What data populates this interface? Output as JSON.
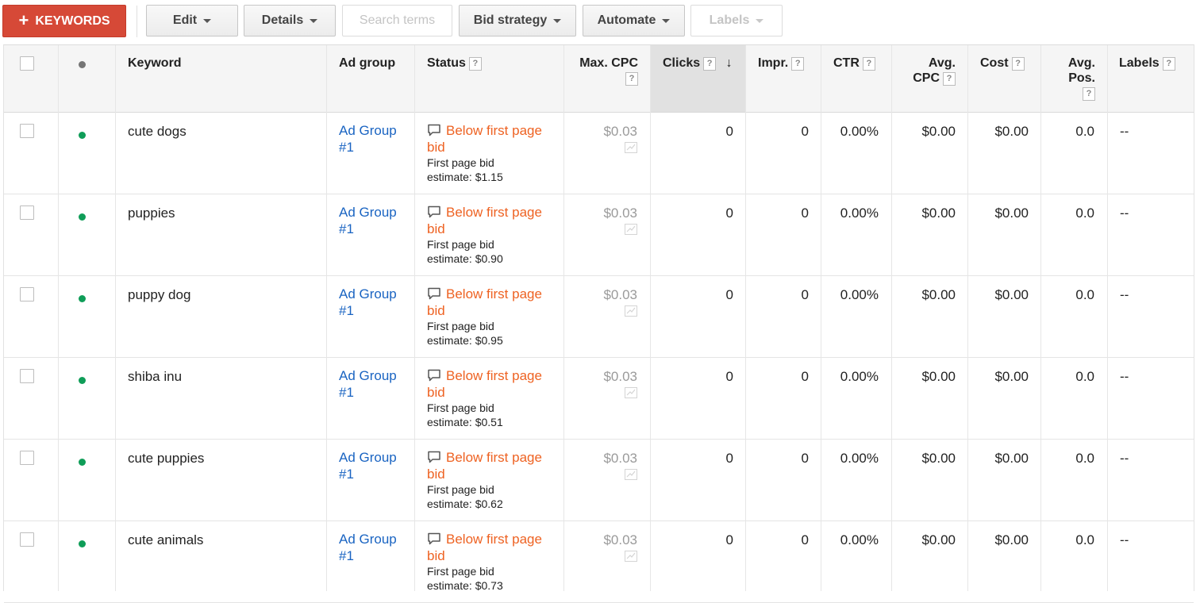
{
  "toolbar": {
    "add_keywords_label": "KEYWORDS",
    "edit_label": "Edit",
    "details_label": "Details",
    "search_terms_label": "Search terms",
    "bid_strategy_label": "Bid strategy",
    "automate_label": "Automate",
    "labels_label": "Labels"
  },
  "columns": {
    "keyword": "Keyword",
    "ad_group": "Ad group",
    "status": "Status",
    "max_cpc": "Max. CPC",
    "clicks": "Clicks",
    "impr": "Impr.",
    "ctr": "CTR",
    "avg_cpc_1": "Avg.",
    "avg_cpc_2": "CPC",
    "cost": "Cost",
    "avg_pos_1": "Avg.",
    "avg_pos_2": "Pos.",
    "labels": "Labels",
    "help_glyph": "?",
    "sort_arrow": "↓"
  },
  "colors": {
    "primary_red": "#d64937",
    "link_blue": "#1a64c2",
    "status_orange": "#ee6222",
    "enabled_green": "#0f9d58",
    "header_dot_gray": "#757575"
  },
  "rows": [
    {
      "keyword": "cute dogs",
      "ad_group_1": "Ad Group",
      "ad_group_2": "#1",
      "status_1": "Below first page",
      "status_2": "bid",
      "status_sub_1": "First page bid",
      "status_sub_2": "estimate: $1.15",
      "max_cpc": "$0.03",
      "clicks": "0",
      "impr": "0",
      "ctr": "0.00%",
      "avg_cpc": "$0.00",
      "cost": "$0.00",
      "avg_pos": "0.0",
      "labels": "--"
    },
    {
      "keyword": "puppies",
      "ad_group_1": "Ad Group",
      "ad_group_2": "#1",
      "status_1": "Below first page",
      "status_2": "bid",
      "status_sub_1": "First page bid",
      "status_sub_2": "estimate: $0.90",
      "max_cpc": "$0.03",
      "clicks": "0",
      "impr": "0",
      "ctr": "0.00%",
      "avg_cpc": "$0.00",
      "cost": "$0.00",
      "avg_pos": "0.0",
      "labels": "--"
    },
    {
      "keyword": "puppy dog",
      "ad_group_1": "Ad Group",
      "ad_group_2": "#1",
      "status_1": "Below first page",
      "status_2": "bid",
      "status_sub_1": "First page bid",
      "status_sub_2": "estimate: $0.95",
      "max_cpc": "$0.03",
      "clicks": "0",
      "impr": "0",
      "ctr": "0.00%",
      "avg_cpc": "$0.00",
      "cost": "$0.00",
      "avg_pos": "0.0",
      "labels": "--"
    },
    {
      "keyword": "shiba inu",
      "ad_group_1": "Ad Group",
      "ad_group_2": "#1",
      "status_1": "Below first page",
      "status_2": "bid",
      "status_sub_1": "First page bid",
      "status_sub_2": "estimate: $0.51",
      "max_cpc": "$0.03",
      "clicks": "0",
      "impr": "0",
      "ctr": "0.00%",
      "avg_cpc": "$0.00",
      "cost": "$0.00",
      "avg_pos": "0.0",
      "labels": "--"
    },
    {
      "keyword": "cute puppies",
      "ad_group_1": "Ad Group",
      "ad_group_2": "#1",
      "status_1": "Below first page",
      "status_2": "bid",
      "status_sub_1": "First page bid",
      "status_sub_2": "estimate: $0.62",
      "max_cpc": "$0.03",
      "clicks": "0",
      "impr": "0",
      "ctr": "0.00%",
      "avg_cpc": "$0.00",
      "cost": "$0.00",
      "avg_pos": "0.0",
      "labels": "--"
    },
    {
      "keyword": "cute animals",
      "ad_group_1": "Ad Group",
      "ad_group_2": "#1",
      "status_1": "Below first page",
      "status_2": "bid",
      "status_sub_1": "First page bid",
      "status_sub_2": "estimate: $0.73",
      "max_cpc": "$0.03",
      "clicks": "0",
      "impr": "0",
      "ctr": "0.00%",
      "avg_cpc": "$0.00",
      "cost": "$0.00",
      "avg_pos": "0.0",
      "labels": "--"
    }
  ]
}
